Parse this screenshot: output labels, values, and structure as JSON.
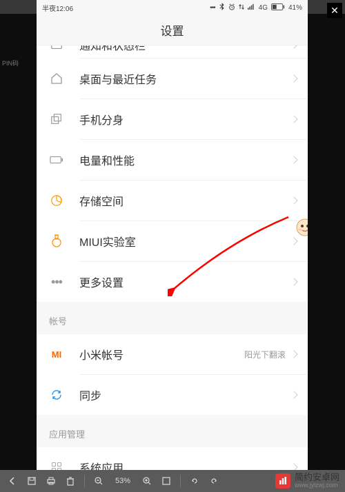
{
  "statusbar": {
    "time": "半夜12:06",
    "network": "4G",
    "battery": "41%"
  },
  "header": {
    "title": "设置"
  },
  "rows": [
    {
      "label": "通知和状态栏"
    },
    {
      "label": "桌面与最近任务"
    },
    {
      "label": "手机分身"
    },
    {
      "label": "电量和性能"
    },
    {
      "label": "存储空间"
    },
    {
      "label": "MIUI实验室"
    },
    {
      "label": "更多设置"
    }
  ],
  "sections": {
    "account": "帐号",
    "appmgmt": "应用管理"
  },
  "account_rows": [
    {
      "label": "小米帐号",
      "value": "阳光下翻滚"
    },
    {
      "label": "同步"
    }
  ],
  "app_rows": [
    {
      "label": "系统应用"
    }
  ],
  "bottom_toolbar": {
    "zoom": "53%"
  },
  "watermark": {
    "title": "简约安卓网",
    "url": "www.jylzwj.com"
  },
  "dark_label": "PIN码",
  "colors": {
    "accent_orange": "#ff6800",
    "accent_red": "#e53935"
  }
}
